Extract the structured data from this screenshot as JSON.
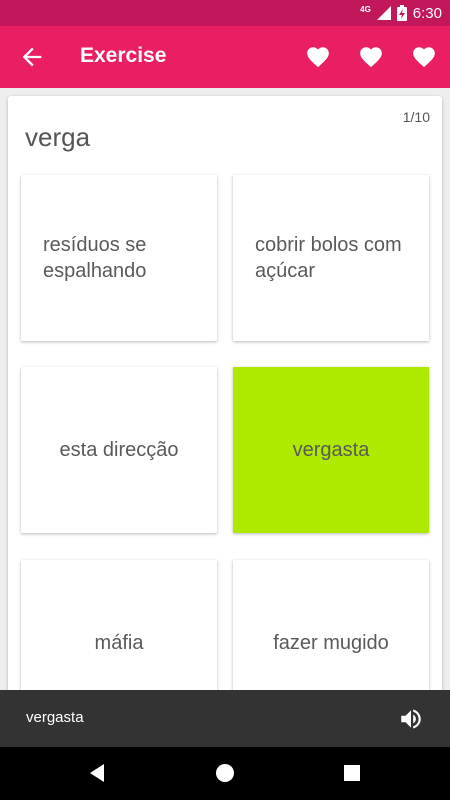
{
  "status": {
    "network": "4G",
    "time": "6:30"
  },
  "app_bar": {
    "title": "Exercise"
  },
  "exercise": {
    "counter": "1/10",
    "word": "verga"
  },
  "options": [
    {
      "label": "resíduos se espalhando",
      "selected": false
    },
    {
      "label": "cobrir bolos com açúcar",
      "selected": false
    },
    {
      "label": "esta direcção",
      "selected": false
    },
    {
      "label": "vergasta",
      "selected": true
    },
    {
      "label": "máfia",
      "selected": false
    },
    {
      "label": "fazer mugido",
      "selected": false
    }
  ],
  "bottom_bar": {
    "text": "vergasta"
  },
  "colors": {
    "primary": "#e91e63",
    "primary_dark": "#c2185b",
    "selected": "#aeea00"
  },
  "icons": [
    "back-arrow-icon",
    "heart-icon",
    "speaker-icon",
    "nav-back-icon",
    "nav-home-icon",
    "nav-recents-icon"
  ]
}
